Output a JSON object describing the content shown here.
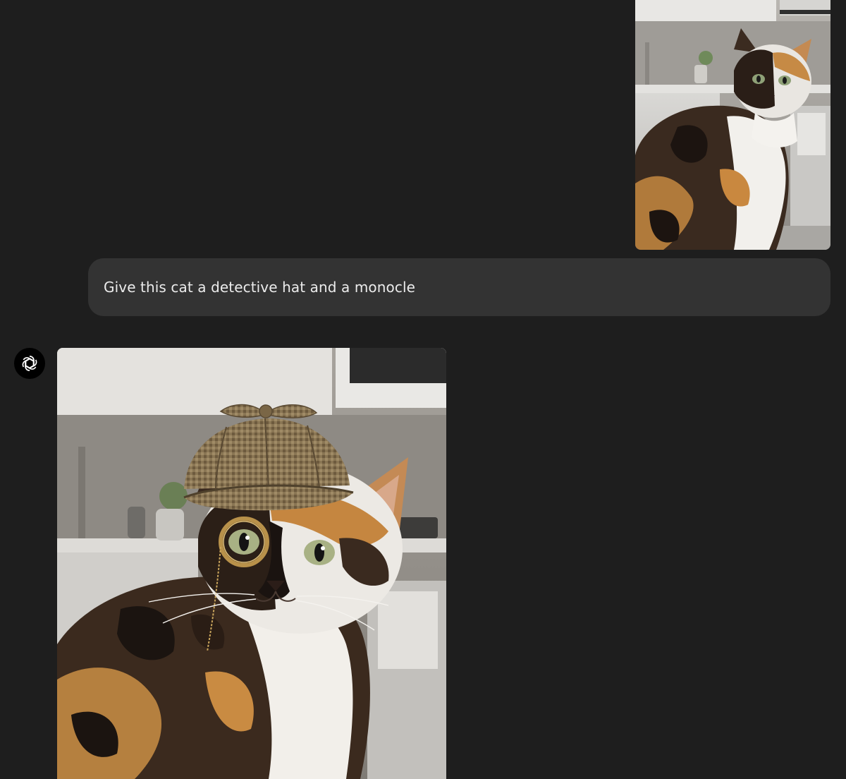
{
  "conversation": {
    "user_message": {
      "image": {
        "icon": "calico-cat-photo"
      },
      "text": "Give this cat a detective hat and a monocle"
    },
    "assistant_message": {
      "avatar_icon": "openai-logo-icon",
      "image": {
        "icon": "calico-cat-detective-photo"
      }
    }
  },
  "colors": {
    "background": "#1e1e1e",
    "bubble": "#333333",
    "text": "#ececec",
    "avatar_bg": "#000000"
  }
}
